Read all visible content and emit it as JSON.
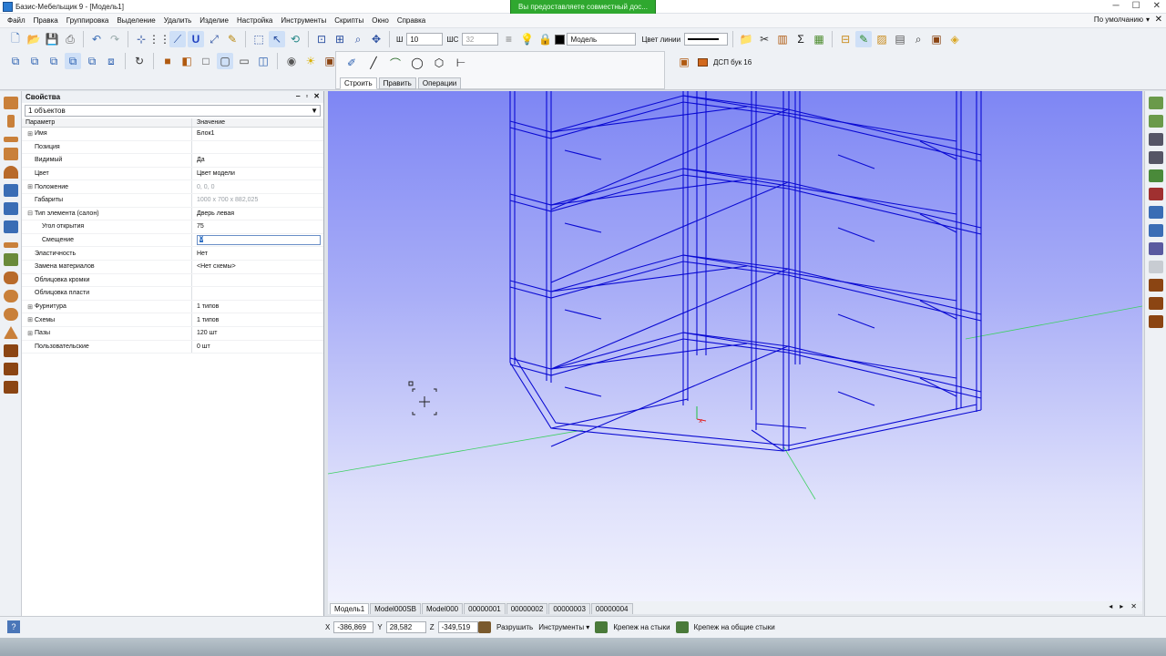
{
  "window": {
    "title": "Базис-Мебельщик 9 - [Модель1]"
  },
  "share_banner": "Вы предоставляете совместный дос...",
  "menu": {
    "items": [
      "Файл",
      "Правка",
      "Группировка",
      "Выделение",
      "Удалить",
      "Изделие",
      "Настройка",
      "Инструменты",
      "Скрипты",
      "Окно",
      "Справка"
    ],
    "preset": "По умолчанию"
  },
  "toolbar": {
    "w_label": "Ш",
    "w_value": "10",
    "shc_label": "ШС",
    "shc_value": "32",
    "layer_value": "Модель",
    "line_color_label": "Цвет линии"
  },
  "draw_panel": {
    "tabs": [
      "Строить",
      "Править",
      "Операции"
    ]
  },
  "material": {
    "name": "ДСП бук 16"
  },
  "properties": {
    "title": "Свойства",
    "selection": "1 объектов",
    "col_param": "Параметр",
    "col_value": "Значение",
    "rows": [
      {
        "name": "Имя",
        "value": "Блок1",
        "exp": "⊞",
        "indent": 0
      },
      {
        "name": "Позиция",
        "value": "",
        "exp": "",
        "indent": 0
      },
      {
        "name": "Видимый",
        "value": "Да",
        "exp": "",
        "indent": 0
      },
      {
        "name": "Цвет",
        "value": "Цвет модели",
        "exp": "",
        "indent": 0
      },
      {
        "name": "Положение",
        "value": "0, 0, 0",
        "exp": "⊞",
        "indent": 0,
        "gray": true
      },
      {
        "name": "Габариты",
        "value": "1000 x 700 x 882,025",
        "exp": "",
        "indent": 0,
        "gray": true
      },
      {
        "name": "Тип элемента (салон)",
        "value": "Дверь левая",
        "exp": "⊟",
        "indent": 0
      },
      {
        "name": "Угол открытия",
        "value": "75",
        "exp": "",
        "indent": 1
      },
      {
        "name": "Смещение",
        "value": "0",
        "exp": "",
        "indent": 1,
        "editing": true
      },
      {
        "name": "Эластичность",
        "value": "Нет",
        "exp": "",
        "indent": 0
      },
      {
        "name": "Замена материалов",
        "value": "<Нет схемы>",
        "exp": "",
        "indent": 0
      },
      {
        "name": "Облицовка кромки",
        "value": "",
        "exp": "",
        "indent": 0
      },
      {
        "name": "Облицовка пласти",
        "value": "",
        "exp": "",
        "indent": 0
      },
      {
        "name": "Фурнитура",
        "value": "1 типов",
        "exp": "⊞",
        "indent": 0
      },
      {
        "name": "Схемы",
        "value": "1 типов",
        "exp": "⊞",
        "indent": 0
      },
      {
        "name": "Пазы",
        "value": "120 шт",
        "exp": "⊞",
        "indent": 0
      },
      {
        "name": "Пользовательские",
        "value": "0 шт",
        "exp": "",
        "indent": 0
      }
    ]
  },
  "view_tabs": [
    "Модель1",
    "Model000SB",
    "Model000",
    "00000001",
    "00000002",
    "00000003",
    "00000004"
  ],
  "status": {
    "x_label": "X",
    "x_value": "-386,869",
    "y_label": "Y",
    "y_value": "28,582",
    "z_label": "Z",
    "z_value": "-349,519",
    "actions": [
      "Разрушить",
      "Инструменты",
      "Крепеж на стыки",
      "Крепеж на общие стыки"
    ]
  },
  "colors": {
    "viewport_top": "#7e86f4",
    "wireframe": "#0a0ad2",
    "share_banner": "#2fa82f"
  }
}
